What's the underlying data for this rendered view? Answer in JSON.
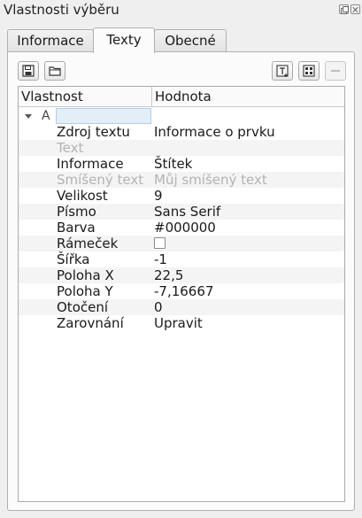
{
  "window": {
    "title": "Vlastnosti výběru"
  },
  "tabs": [
    {
      "label": "Informace"
    },
    {
      "label": "Texty"
    },
    {
      "label": "Obecné"
    }
  ],
  "tree": {
    "header": {
      "property": "Vlastnost",
      "value": "Hodnota"
    },
    "root": {
      "label": "A",
      "value": ""
    },
    "rows": [
      {
        "name": "Zdroj textu",
        "value": "Informace o prvku",
        "disabled": false
      },
      {
        "name": "Text",
        "value": "",
        "disabled": true
      },
      {
        "name": "Informace",
        "value": "Štítek",
        "disabled": false
      },
      {
        "name": "Smíšený text",
        "value": "Můj smíšený text",
        "disabled": true
      },
      {
        "name": "Velikost",
        "value": "9",
        "disabled": false
      },
      {
        "name": "Písmo",
        "value": "Sans Serif",
        "disabled": false
      },
      {
        "name": "Barva",
        "value": "#000000",
        "disabled": false
      },
      {
        "name": "Rámeček",
        "value": "",
        "checked": false,
        "disabled": false
      },
      {
        "name": "Šířka",
        "value": "-1",
        "disabled": false
      },
      {
        "name": "Poloha X",
        "value": "22,5",
        "disabled": false
      },
      {
        "name": "Poloha Y",
        "value": "-7,16667",
        "disabled": false
      },
      {
        "name": "Otočení",
        "value": "0",
        "disabled": false
      },
      {
        "name": "Zarovnání",
        "value": "Upravit",
        "disabled": false
      }
    ]
  },
  "toolbar": {
    "icons": [
      "save-icon",
      "open-folder-icon",
      "text-field-icon",
      "grid-icon",
      "minus-icon"
    ]
  }
}
